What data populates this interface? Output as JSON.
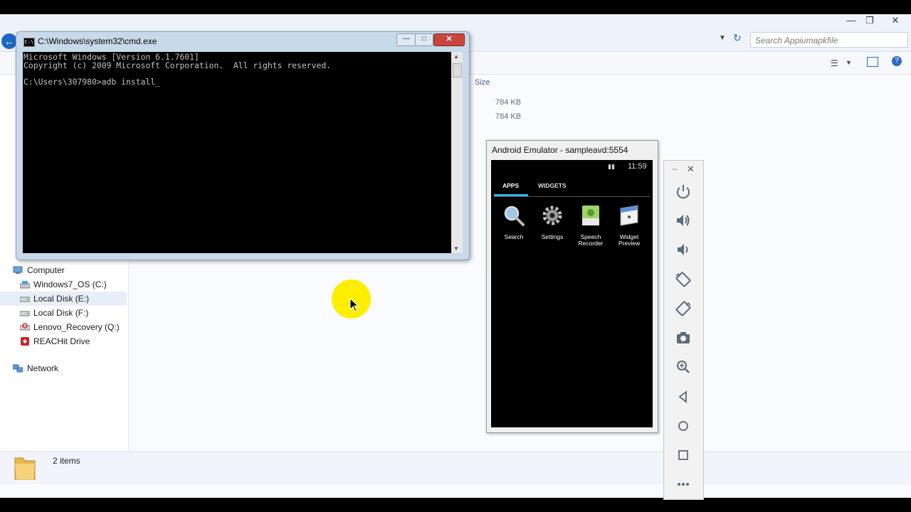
{
  "explorer": {
    "search_placeholder": "Search Appiumapkfile",
    "column_size": "Size",
    "file_sizes": [
      "784 KB",
      "784 KB"
    ],
    "nav": [
      {
        "label": "Computer",
        "icon": "computer-icon"
      },
      {
        "label": "Windows7_OS (C:)",
        "icon": "drive-icon"
      },
      {
        "label": "Local Disk (E:)",
        "icon": "drive-icon"
      },
      {
        "label": "Local Disk (F:)",
        "icon": "drive-icon"
      },
      {
        "label": "Lenovo_Recovery (Q:)",
        "icon": "recovery-drive-icon"
      },
      {
        "label": "REACHit Drive",
        "icon": "reachit-drive-icon"
      },
      {
        "label": "Network",
        "icon": "network-icon"
      }
    ],
    "status_items": "2 items"
  },
  "cmd": {
    "title": "C:\\Windows\\system32\\cmd.exe",
    "icon_text": "C:\\",
    "lines": [
      "Microsoft Windows [Version 6.1.7601]",
      "Copyright (c) 2009 Microsoft Corporation.  All rights reserved.",
      "",
      "C:\\Users\\307980>adb install_"
    ]
  },
  "emulator": {
    "title": "Android Emulator - sampleavd:5554",
    "time": "11:59",
    "tabs": [
      "APPS",
      "WIDGETS"
    ],
    "apps": [
      {
        "label": "Search",
        "icon": "search-icon"
      },
      {
        "label": "Settings",
        "icon": "settings-gear-icon"
      },
      {
        "label": "Speech Recorder",
        "icon": "speech-recorder-icon"
      },
      {
        "label": "Widget Preview",
        "icon": "widget-preview-icon"
      }
    ],
    "controls": [
      "power-icon",
      "volume-up-icon",
      "volume-down-icon",
      "rotate-left-icon",
      "rotate-right-icon",
      "camera-icon",
      "zoom-icon",
      "back-icon",
      "home-icon",
      "overview-icon",
      "more-icon"
    ]
  },
  "colors": {
    "cmd_background": "#000000",
    "cmd_text": "#c0c0c0",
    "close_button": "#c9463d",
    "cursor_highlight": "#ffee00",
    "android_tab_accent": "#33b5e5"
  }
}
